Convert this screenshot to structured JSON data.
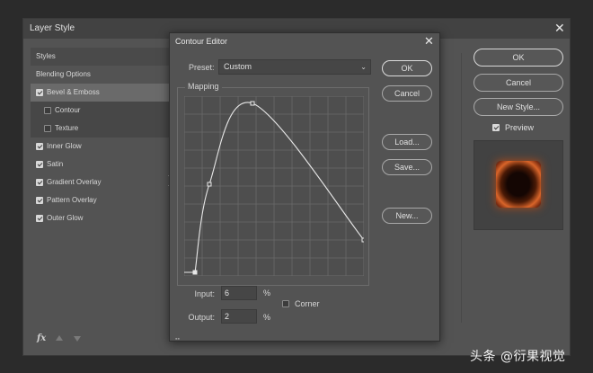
{
  "layer_style": {
    "title": "Layer Style",
    "styles_header": "Styles",
    "items": [
      {
        "label": "Blending Options",
        "checkbox": false,
        "checked": false
      },
      {
        "label": "Bevel & Emboss",
        "checkbox": true,
        "checked": true,
        "selected": true
      },
      {
        "label": "Contour",
        "checkbox": true,
        "checked": false,
        "child": true
      },
      {
        "label": "Texture",
        "checkbox": true,
        "checked": false,
        "child": true
      },
      {
        "label": "Inner Glow",
        "checkbox": true,
        "checked": true
      },
      {
        "label": "Satin",
        "checkbox": true,
        "checked": true
      },
      {
        "label": "Gradient Overlay",
        "checkbox": true,
        "checked": true
      },
      {
        "label": "Pattern Overlay",
        "checkbox": true,
        "checked": true
      },
      {
        "label": "Outer Glow",
        "checkbox": true,
        "checked": true
      }
    ],
    "fx_label": "fx",
    "buttons": {
      "ok": "OK",
      "cancel": "Cancel",
      "new_style": "New Style..."
    },
    "preview_label": "Preview",
    "preview_checked": true
  },
  "contour_editor": {
    "title": "Contour Editor",
    "preset_label": "Preset:",
    "preset_value": "Custom",
    "mapping_label": "Mapping",
    "buttons": {
      "ok": "OK",
      "cancel": "Cancel",
      "load": "Load...",
      "save": "Save...",
      "new": "New..."
    },
    "input_label": "Input:",
    "input_value": "6",
    "output_label": "Output:",
    "output_value": "2",
    "unit": "%",
    "corner_label": "Corner",
    "corner_checked": false,
    "curve_points": [
      {
        "input": 6,
        "output": 2
      },
      {
        "input": 14,
        "output": 51
      },
      {
        "input": 38,
        "output": 96
      },
      {
        "input": 100,
        "output": 20
      }
    ]
  },
  "watermark": "头条 @衍果视觉",
  "colors": {
    "dialog_bg": "#535353",
    "accent_glow": "#d9652a",
    "curve": "#e8e8e8"
  }
}
